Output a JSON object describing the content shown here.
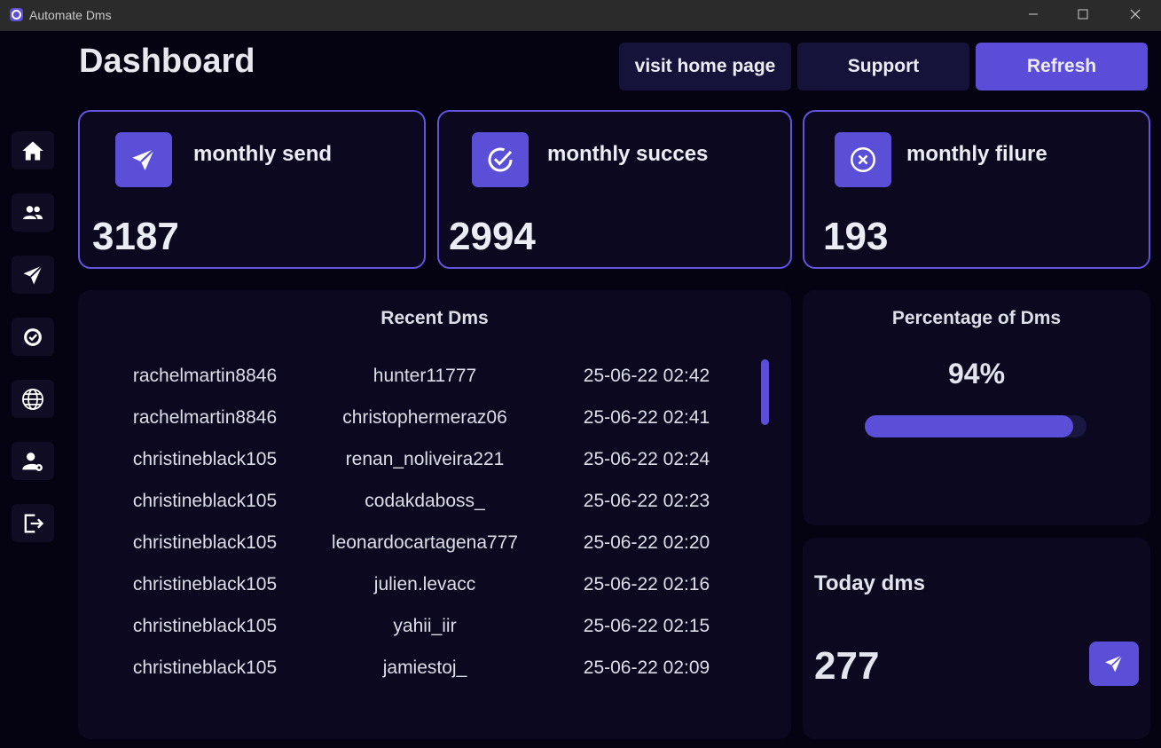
{
  "window": {
    "title": "Automate Dms"
  },
  "header": {
    "title": "Dashboard",
    "visit_label": "visit home page",
    "support_label": "Support",
    "refresh_label": "Refresh"
  },
  "sidebar": {
    "items": [
      {
        "icon": "home-icon"
      },
      {
        "icon": "users-icon"
      },
      {
        "icon": "send-icon"
      },
      {
        "icon": "check-circle-icon"
      },
      {
        "icon": "globe-icon"
      },
      {
        "icon": "user-settings-icon"
      },
      {
        "icon": "logout-icon"
      }
    ]
  },
  "stats": {
    "send": {
      "label": "monthly send",
      "value": "3187"
    },
    "success": {
      "label": "monthly succes",
      "value": "2994"
    },
    "failure": {
      "label": "monthly filure",
      "value": "193"
    }
  },
  "recent": {
    "title": "Recent Dms",
    "rows": [
      [
        "rachelmartin8846",
        "hunter11777",
        "25-06-22 02:42"
      ],
      [
        "rachelmartin8846",
        "christophermeraz06",
        "25-06-22 02:41"
      ],
      [
        "christineblack105",
        "renan_noliveira221",
        "25-06-22 02:24"
      ],
      [
        "christineblack105",
        "codakdaboss_",
        "25-06-22 02:23"
      ],
      [
        "christineblack105",
        "leonardocartagena777",
        "25-06-22 02:20"
      ],
      [
        "christineblack105",
        "julien.levacc",
        "25-06-22 02:16"
      ],
      [
        "christineblack105",
        "yahii_iir",
        "25-06-22 02:15"
      ],
      [
        "christineblack105",
        "jamiestoj_",
        "25-06-22 02:09"
      ]
    ]
  },
  "percentage": {
    "title": "Percentage of Dms",
    "value_label": "94%",
    "value": 0.94
  },
  "today": {
    "title": "Today dms",
    "value": "277"
  },
  "colors": {
    "accent": "#5b4fd8",
    "background": "#050312",
    "card": "#0b0820",
    "border": "#6354dd"
  }
}
